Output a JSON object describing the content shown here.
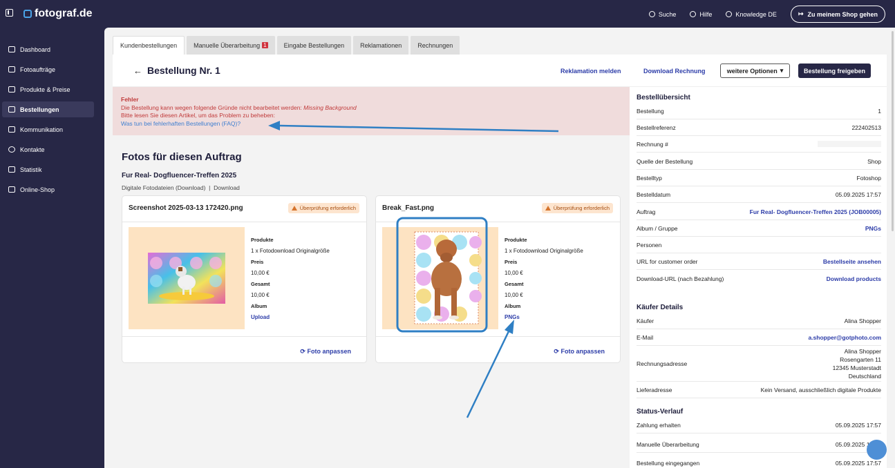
{
  "app": {
    "logo": "fotograf.de"
  },
  "topnav": {
    "search": "Suche",
    "help": "Hilfe",
    "knowledge": "Knowledge DE",
    "shop": "Zu meinem Shop gehen"
  },
  "sidebar": {
    "items": [
      {
        "label": "Dashboard",
        "icon": "home-icon"
      },
      {
        "label": "Fotoaufträge",
        "icon": "image-icon"
      },
      {
        "label": "Produkte & Preise",
        "icon": "cart-icon"
      },
      {
        "label": "Bestellungen",
        "icon": "orders-icon",
        "active": true
      },
      {
        "label": "Kommunikation",
        "icon": "message-icon"
      },
      {
        "label": "Kontakte",
        "icon": "user-icon"
      },
      {
        "label": "Statistik",
        "icon": "chart-icon"
      },
      {
        "label": "Online-Shop",
        "icon": "shop-icon"
      }
    ]
  },
  "tabs": [
    {
      "label": "Kundenbestellungen",
      "active": true
    },
    {
      "label": "Manuelle Überarbeitung",
      "badge": "1"
    },
    {
      "label": "Eingabe Bestellungen"
    },
    {
      "label": "Reklamationen"
    },
    {
      "label": "Rechnungen"
    }
  ],
  "header": {
    "title": "Bestellung Nr. 1",
    "reclaim": "Reklamation melden",
    "download": "Download Rechnung",
    "options": "weitere Optionen",
    "release": "Bestellung freigeben"
  },
  "error": {
    "title": "Fehler",
    "line1": "Die Bestellung kann wegen folgende Gründe nicht bearbeitet werden:",
    "reason": "Missing Background",
    "line2": "Bitte lesen Sie diesen Artikel, um das Problem zu beheben:",
    "link": "Was tun bei fehlerhaften Bestellungen (FAQ)?"
  },
  "photos": {
    "title": "Fotos für diesen Auftrag",
    "order_name": "Fur Real- Dogfluencer-Treffen 2025",
    "delivery_a": "Digitale Fotodateien (Download)",
    "delivery_b": "Download"
  },
  "cards": [
    {
      "name": "Screenshot 2025-03-13 172420.png",
      "warning": "Überprüfung erforderlich",
      "products_label": "Produkte",
      "product": "1 x Fotodownload Originalgröße",
      "price_label": "Preis",
      "price": "10,00 €",
      "total_label": "Gesamt",
      "total": "10,00 €",
      "album_label": "Album",
      "album": "Upload",
      "adjust": "Foto anpassen"
    },
    {
      "name": "Break_Fast.png",
      "warning": "Überprüfung erforderlich",
      "products_label": "Produkte",
      "product": "1 x Fotodownload Originalgröße",
      "price_label": "Preis",
      "price": "10,00 €",
      "total_label": "Gesamt",
      "total": "10,00 €",
      "album_label": "Album",
      "album": "PNGs",
      "adjust": "Foto anpassen"
    }
  ],
  "overview": {
    "title": "Bestellübersicht",
    "rows": [
      {
        "k": "Bestellung",
        "v": "1"
      },
      {
        "k": "Bestellreferenz",
        "v": "222402513"
      },
      {
        "k": "Rechnung #",
        "v": ""
      },
      {
        "k": "Quelle der Bestellung",
        "v": "Shop"
      },
      {
        "k": "Bestelltyp",
        "v": "Fotoshop"
      },
      {
        "k": "Bestelldatum",
        "v": "05.09.2025 17:57"
      },
      {
        "k": "Auftrag",
        "v": "Fur Real- Dogfluencer-Treffen 2025 (JOB00005)"
      },
      {
        "k": "Album / Gruppe",
        "v": "PNGs"
      },
      {
        "k": "Personen",
        "v": ""
      },
      {
        "k": "URL for customer order",
        "v": "Bestellseite ansehen"
      },
      {
        "k": "Download-URL (nach Bezahlung)",
        "v": "Download products"
      }
    ]
  },
  "buyer": {
    "title": "Käufer Details",
    "buyer_label": "Käufer",
    "buyer": "Alina Shopper",
    "email_label": "E-Mail",
    "email": "a.shopper@gotphoto.com",
    "address_label": "Rechnungsadresse",
    "address": [
      "Alina Shopper",
      "Rosengarten 11",
      "12345 Musterstadt",
      "Deutschland"
    ],
    "delivery_label": "Lieferadresse",
    "delivery": "Kein Versand, ausschließlich digitale Produkte"
  },
  "status": {
    "title": "Status-Verlauf",
    "rows": [
      {
        "k": "Zahlung erhalten",
        "v": "05.09.2025 17:57"
      },
      {
        "k": "Manuelle Überarbeitung",
        "v": "05.09.2025 17:57"
      },
      {
        "k": "Bestellung eingegangen",
        "v": "05.09.2025 17:57"
      }
    ]
  },
  "colors": {
    "brand": "#272746",
    "link": "#2c3ca8",
    "error_bg": "#f0dcdc",
    "error_text": "#c03a3a",
    "annotation": "#2f7fc4"
  }
}
